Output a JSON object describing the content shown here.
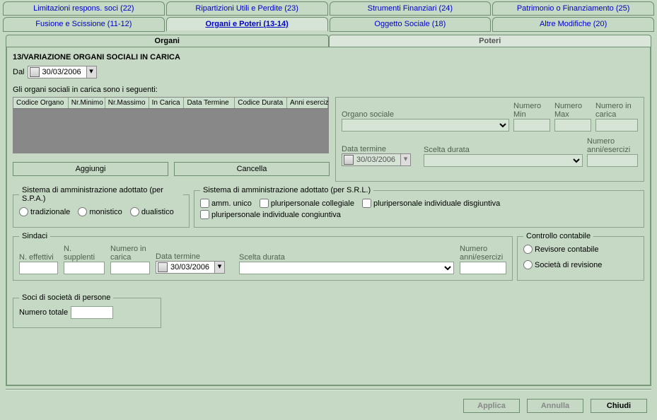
{
  "tabs_upper": [
    {
      "label": "Limitazioni respons. soci (22)"
    },
    {
      "label": "Ripartizioni Utili e Perdite (23)"
    },
    {
      "label": "Strumenti Finanziari (24)"
    },
    {
      "label": "Patrimonio o Finanziamento (25)"
    }
  ],
  "tabs_lower": [
    {
      "label": "Fusione e Scissione (11-12)"
    },
    {
      "label": "Organi e Poteri (13-14)",
      "selected": true
    },
    {
      "label": "Oggetto Sociale (18)"
    },
    {
      "label": "Altre Modifiche (20)"
    }
  ],
  "subtabs": {
    "left": "Organi",
    "right": "Poteri"
  },
  "section": {
    "title": "13/VARIAZIONE ORGANI SOCIALI IN CARICA",
    "dal_label": "Dal",
    "dal_value": "30/03/2006",
    "intro": "Gli organi sociali in carica sono i seguenti:"
  },
  "grid": {
    "cols": [
      "Codice Organo",
      "Nr.Minimo",
      "Nr.Massimo",
      "In Carica",
      "Data Termine",
      "Codice Durata",
      "Anni esercizi"
    ]
  },
  "buttons": {
    "aggiungi": "Aggiungi",
    "cancella": "Cancella"
  },
  "rightPane": {
    "organo_sociale": "Organo sociale",
    "numero_min": "Numero Min",
    "numero_max": "Numero Max",
    "numero_in_carica": "Numero in carica",
    "data_termine": "Data termine",
    "scelta_durata": "Scelta durata",
    "numero_anni": "Numero anni/esercizi",
    "date_val": "30/03/2006"
  },
  "spa": {
    "legend": "Sistema di amministrazione adottato (per S.P.A.)",
    "opts": [
      "tradizionale",
      "monistico",
      "dualistico"
    ]
  },
  "srl": {
    "legend": "Sistema di amministrazione adottato (per S.R.L.)",
    "opts": [
      "amm. unico",
      "pluripersonale collegiale",
      "pluripersonale  individuale disgiuntiva",
      "pluripersonale individuale congiuntiva"
    ]
  },
  "sindaci": {
    "legend": "Sindaci",
    "labels": {
      "n_effettivi": "N. effettivi",
      "n_supplenti": "N. supplenti",
      "numero_in_carica": "Numero in carica",
      "data_termine": "Data termine",
      "scelta_durata": "Scelta durata",
      "numero_anni": "Numero anni/esercizi"
    },
    "date_val": "30/03/2006"
  },
  "controllo": {
    "legend": "Controllo contabile",
    "opts": [
      "Revisore contabile",
      "Società di revisione"
    ]
  },
  "soci": {
    "legend": "Soci di società di persone",
    "label": "Numero totale"
  },
  "bottom": {
    "applica": "Applica",
    "annulla": "Annulla",
    "chiudi": "Chiudi"
  }
}
